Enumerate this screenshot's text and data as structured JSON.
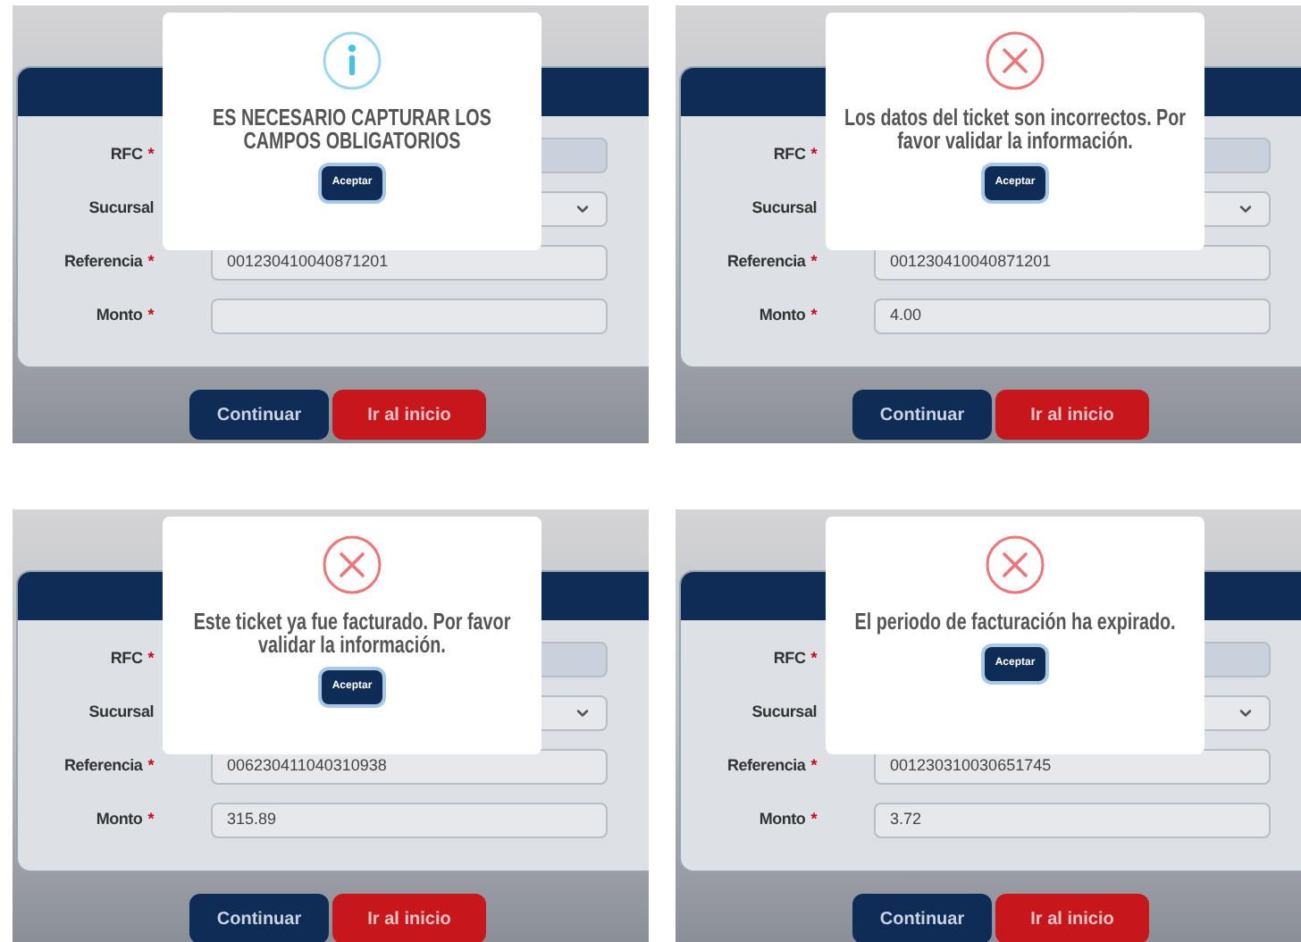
{
  "panels": [
    {
      "dialog": {
        "kind": "info",
        "message": "ES NECESARIO CAPTURAR LOS CAMPOS OBLIGATORIOS",
        "button": "Aceptar"
      },
      "form": {
        "fields": [
          {
            "label": "RFC",
            "mark": "*",
            "kind": "text",
            "disabled": true
          },
          {
            "label": "Sucursal",
            "kind": "select",
            "disabled": false
          },
          {
            "label": "Referencia",
            "mark": "*",
            "kind": "text",
            "value": "001230410040871201",
            "disabled": false
          },
          {
            "label": "Monto",
            "mark": "*",
            "kind": "text",
            "disabled": false
          }
        ]
      },
      "buttons": [
        {
          "label": "Continuar",
          "kind": "primary"
        },
        {
          "label": "Ir al inicio",
          "kind": "danger"
        }
      ]
    },
    {
      "dialog": {
        "kind": "error",
        "message": "Los datos del ticket son incorrectos. Por favor validar la información.",
        "button": "Aceptar"
      },
      "form": {
        "fields": [
          {
            "label": "RFC",
            "mark": "*",
            "kind": "text",
            "disabled": true
          },
          {
            "label": "Sucursal",
            "kind": "select",
            "disabled": false
          },
          {
            "label": "Referencia",
            "mark": "*",
            "kind": "text",
            "value": "001230410040871201",
            "disabled": false
          },
          {
            "label": "Monto",
            "mark": "*",
            "kind": "text",
            "value": "4.00",
            "disabled": false
          }
        ]
      },
      "buttons": [
        {
          "label": "Continuar",
          "kind": "primary"
        },
        {
          "label": "Ir al inicio",
          "kind": "danger"
        }
      ]
    },
    {
      "dialog": {
        "kind": "error",
        "message": "Este ticket ya fue facturado. Por favor validar la información.",
        "button": "Aceptar"
      },
      "form": {
        "fields": [
          {
            "label": "RFC",
            "mark": "*",
            "kind": "text",
            "disabled": true
          },
          {
            "label": "Sucursal",
            "kind": "select",
            "disabled": false
          },
          {
            "label": "Referencia",
            "mark": "*",
            "kind": "text",
            "value": "006230411040310938",
            "disabled": false
          },
          {
            "label": "Monto",
            "mark": "*",
            "kind": "text",
            "value": "315.89",
            "disabled": false
          }
        ]
      },
      "buttons": [
        {
          "label": "Continuar",
          "kind": "primary"
        },
        {
          "label": "Ir al inicio",
          "kind": "danger"
        }
      ]
    },
    {
      "dialog": {
        "kind": "error",
        "message": "El periodo de facturación ha expirado.",
        "button": "Aceptar"
      },
      "form": {
        "fields": [
          {
            "label": "RFC",
            "mark": "*",
            "kind": "text",
            "disabled": true
          },
          {
            "label": "Sucursal",
            "kind": "select",
            "disabled": false
          },
          {
            "label": "Referencia",
            "mark": "*",
            "kind": "text",
            "value": "001230310030651745",
            "disabled": false
          },
          {
            "label": "Monto",
            "mark": "*",
            "kind": "text",
            "value": "3.72",
            "disabled": false
          }
        ]
      },
      "buttons": [
        {
          "label": "Continuar",
          "kind": "primary"
        },
        {
          "label": "Ir al inicio",
          "kind": "danger"
        }
      ]
    }
  ]
}
